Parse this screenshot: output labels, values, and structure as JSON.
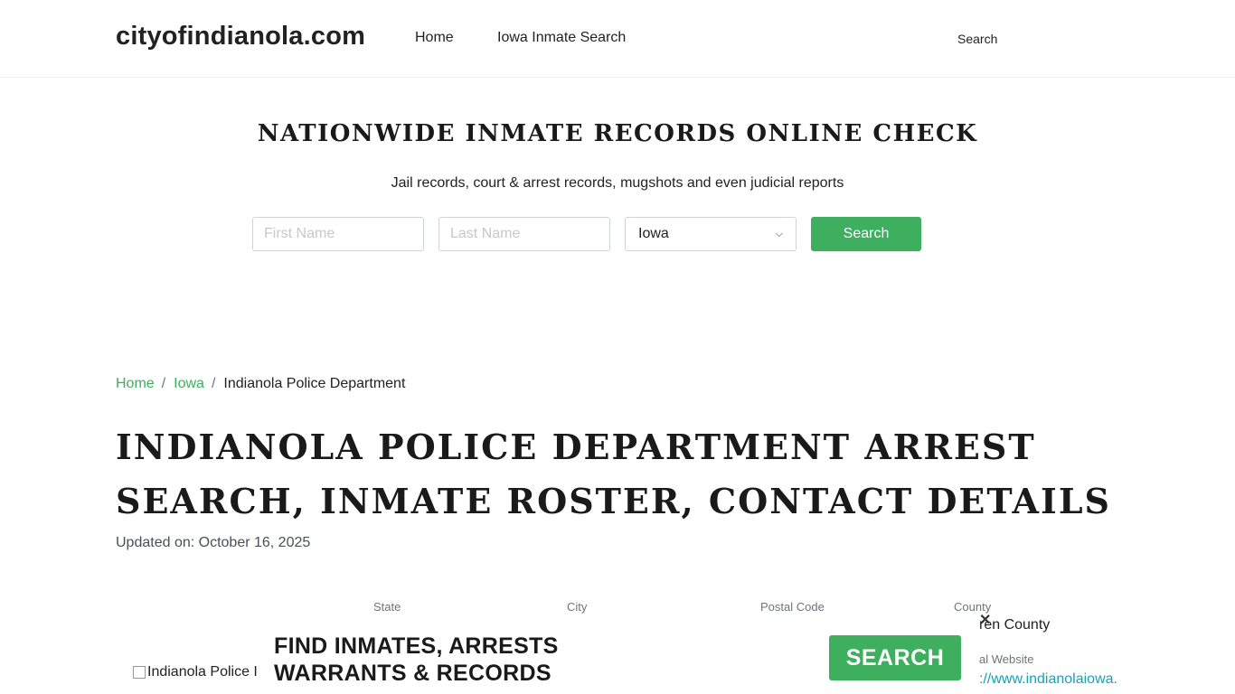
{
  "header": {
    "brand": "cityofindianola.com",
    "nav": {
      "home": "Home",
      "iowa": "Iowa Inmate Search",
      "search": "Search"
    }
  },
  "hero": {
    "title": "NATIONWIDE INMATE RECORDS ONLINE CHECK",
    "subtitle": "Jail records, court & arrest records, mugshots and even judicial reports",
    "form": {
      "first_placeholder": "First Name",
      "last_placeholder": "Last Name",
      "state_value": "Iowa",
      "search_label": "Search"
    }
  },
  "breadcrumb": {
    "home": "Home",
    "state": "Iowa",
    "current": "Indianola Police Department"
  },
  "page": {
    "title": "INDIANOLA POLICE DEPARTMENT ARREST SEARCH, INMATE ROSTER, CONTACT DETAILS",
    "updated": "Updated on: October 16, 2025"
  },
  "info": {
    "state_label": "State",
    "city_label": "City",
    "postal_label": "Postal Code",
    "county_label": "County",
    "county_value": "ren County",
    "website_label": "al Website",
    "website_value": "://www.indianolaiowa."
  },
  "ad": {
    "image_alt": "Indianola Police I",
    "line1": "FIND INMATES, ARRESTS",
    "line2": "WARRANTS & RECORDS",
    "button": "SEARCH",
    "close": "✕"
  }
}
